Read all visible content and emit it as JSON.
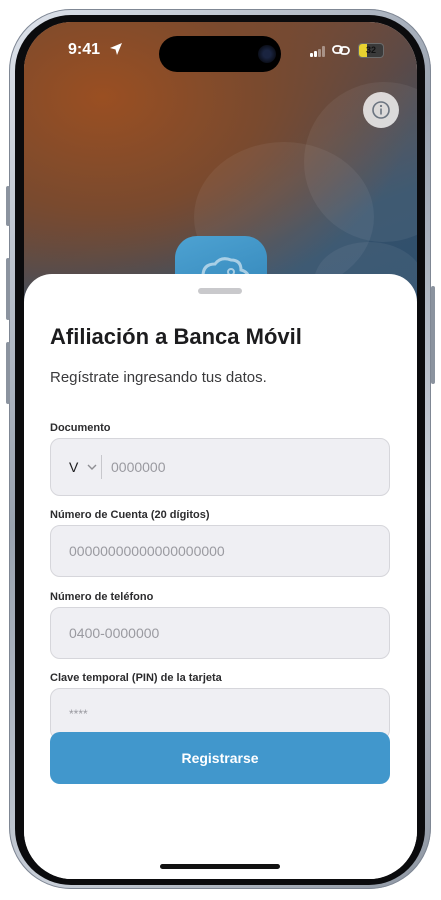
{
  "status_bar": {
    "time": "9:41",
    "battery": "32",
    "battery_level": 0.32
  },
  "form": {
    "title": "Afiliación a Banca Móvil",
    "subtitle": "Regístrate ingresando tus datos.",
    "document": {
      "label": "Documento",
      "type": "V",
      "placeholder": "0000000"
    },
    "account": {
      "label": "Número de Cuenta (20 dígitos)",
      "placeholder": "00000000000000000000"
    },
    "phone": {
      "label": "Número de teléfono",
      "placeholder": "0400-0000000"
    },
    "pin": {
      "label": "Clave temporal (PIN) de la tarjeta",
      "placeholder": "****"
    },
    "submit": "Registrarse"
  },
  "colors": {
    "primary": "#4197cc",
    "field_bg": "#efeff3"
  }
}
